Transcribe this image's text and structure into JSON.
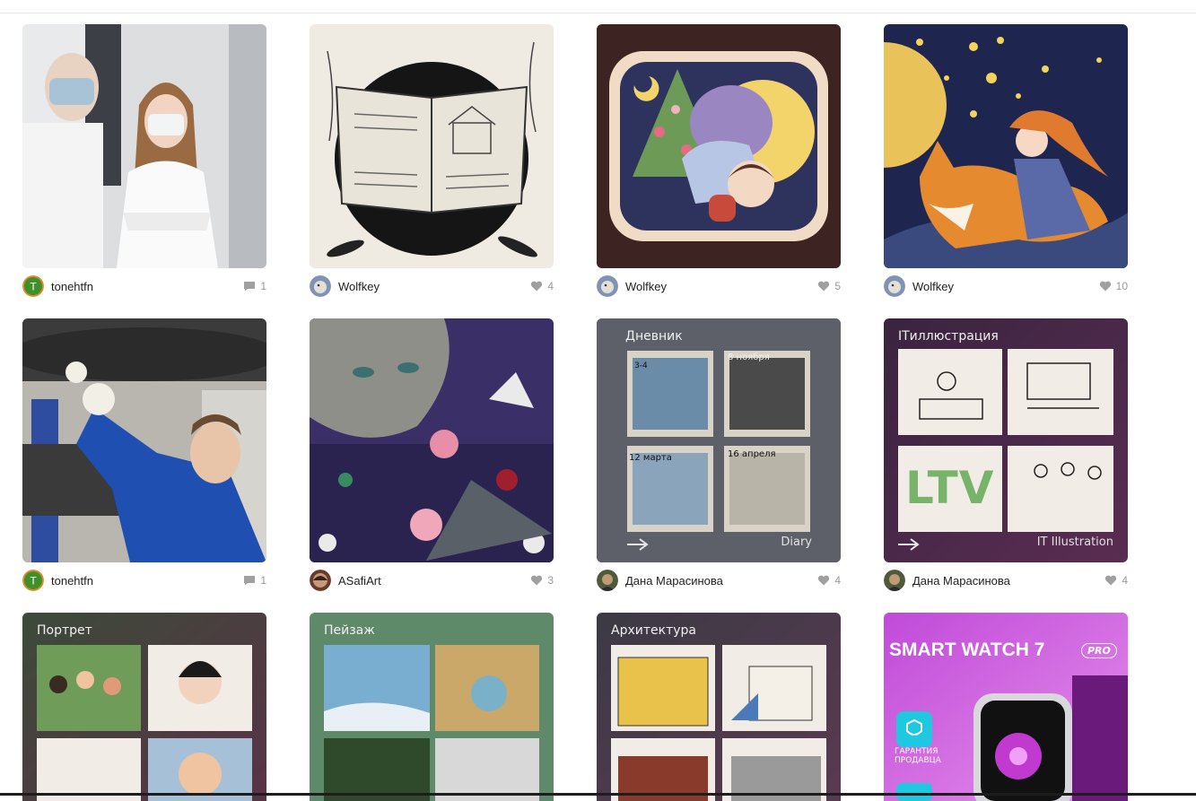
{
  "cards": [
    {
      "author": "tonehtfn",
      "count": "1",
      "icon": "comment-icon",
      "avatar_initial": "T"
    },
    {
      "author": "Wolfkey",
      "count": "4",
      "icon": "heart-icon"
    },
    {
      "author": "Wolfkey",
      "count": "5",
      "icon": "heart-icon"
    },
    {
      "author": "Wolfkey",
      "count": "10",
      "icon": "heart-icon"
    },
    {
      "author": "tonehtfn",
      "count": "1",
      "icon": "comment-icon",
      "avatar_initial": "T"
    },
    {
      "author": "ASafiArt",
      "count": "3",
      "icon": "heart-icon"
    },
    {
      "author": "Дана Марасинова",
      "count": "4",
      "icon": "heart-icon"
    },
    {
      "author": "Дана Марасинова",
      "count": "4",
      "icon": "heart-icon"
    },
    {
      "author": "",
      "count": "",
      "icon": ""
    },
    {
      "author": "",
      "count": "",
      "icon": ""
    },
    {
      "author": "",
      "count": "",
      "icon": ""
    },
    {
      "author": "",
      "count": "",
      "icon": ""
    }
  ],
  "thumbs": {
    "diary_title": "Дневник",
    "diary_sub": "Diary",
    "diary_d1": "3-4",
    "diary_d2": "8 ноября",
    "diary_d3": "12 марта",
    "diary_d4": "16 апреля",
    "it_title": "ITиллюстрация",
    "it_sub": "IT Illustration",
    "it_ltv": "LTV",
    "portrait_title": "Портрет",
    "landscape_title": "Пейзаж",
    "arch_title": "Архитектура",
    "ad_title": "SMART WATCH 7",
    "ad_badge": "PRO",
    "ad_guarantee": "ГАРАНТИЯ ПРОДАВЦА"
  },
  "colors": {
    "avatar_green": "#3f8f2a",
    "stat_grey": "#a0a0a0"
  }
}
